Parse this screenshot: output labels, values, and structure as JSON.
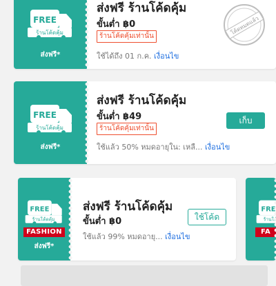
{
  "colors": {
    "teal": "#26aa99",
    "red": "#ee4d2d",
    "link": "#1f6fe0",
    "fashion": "#d0011b"
  },
  "vouchers": [
    {
      "badge_free": "FREE",
      "badge_sub": "ร้านโค้ดคุ้ม",
      "stub_label": "ส่งฟรี*",
      "title": "ส่งฟรี ร้านโค้ดคุ้ม",
      "min_spend": "ขั้นต่ำ ฿0",
      "tag": "ร้านโค้ดคุ้มเท่านั้น",
      "info": "ใช้ได้ถึง 01 ก.ค.",
      "condition_link": "เงื่อนไข",
      "stamp_text": "โค้ดหมดแล้ว"
    },
    {
      "badge_free": "FREE",
      "badge_sub": "ร้านโค้ดคุ้ม",
      "stub_label": "ส่งฟรี*",
      "title": "ส่งฟรี ร้านโค้ดคุ้ม",
      "min_spend": "ขั้นต่ำ ฿49",
      "tag": "ร้านโค้ดคุ้มเท่านั้น",
      "info": "ใช้แล้ว 50% หมดอายุใน: เหลื...",
      "condition_link": "เงื่อนไข",
      "button": "เก็บ"
    },
    {
      "badge_free": "FREE",
      "badge_sub": "ร้านโค้ดคุ้ม",
      "fashion_label": "FASHION",
      "stub_label": "ส่งฟรี*",
      "title": "ส่งฟรี ร้านโค้ดคุ้ม",
      "min_spend": "ขั้นต่ำ ฿0",
      "info": "ใช้แล้ว 99% หมดอายุ...",
      "condition_link": "เงื่อนไข",
      "button": "ใช้โค้ด"
    },
    {
      "badge_free": "FREE",
      "badge_sub": "ร้านโค้ดคุ้ม",
      "fashion_label": "FA"
    }
  ]
}
